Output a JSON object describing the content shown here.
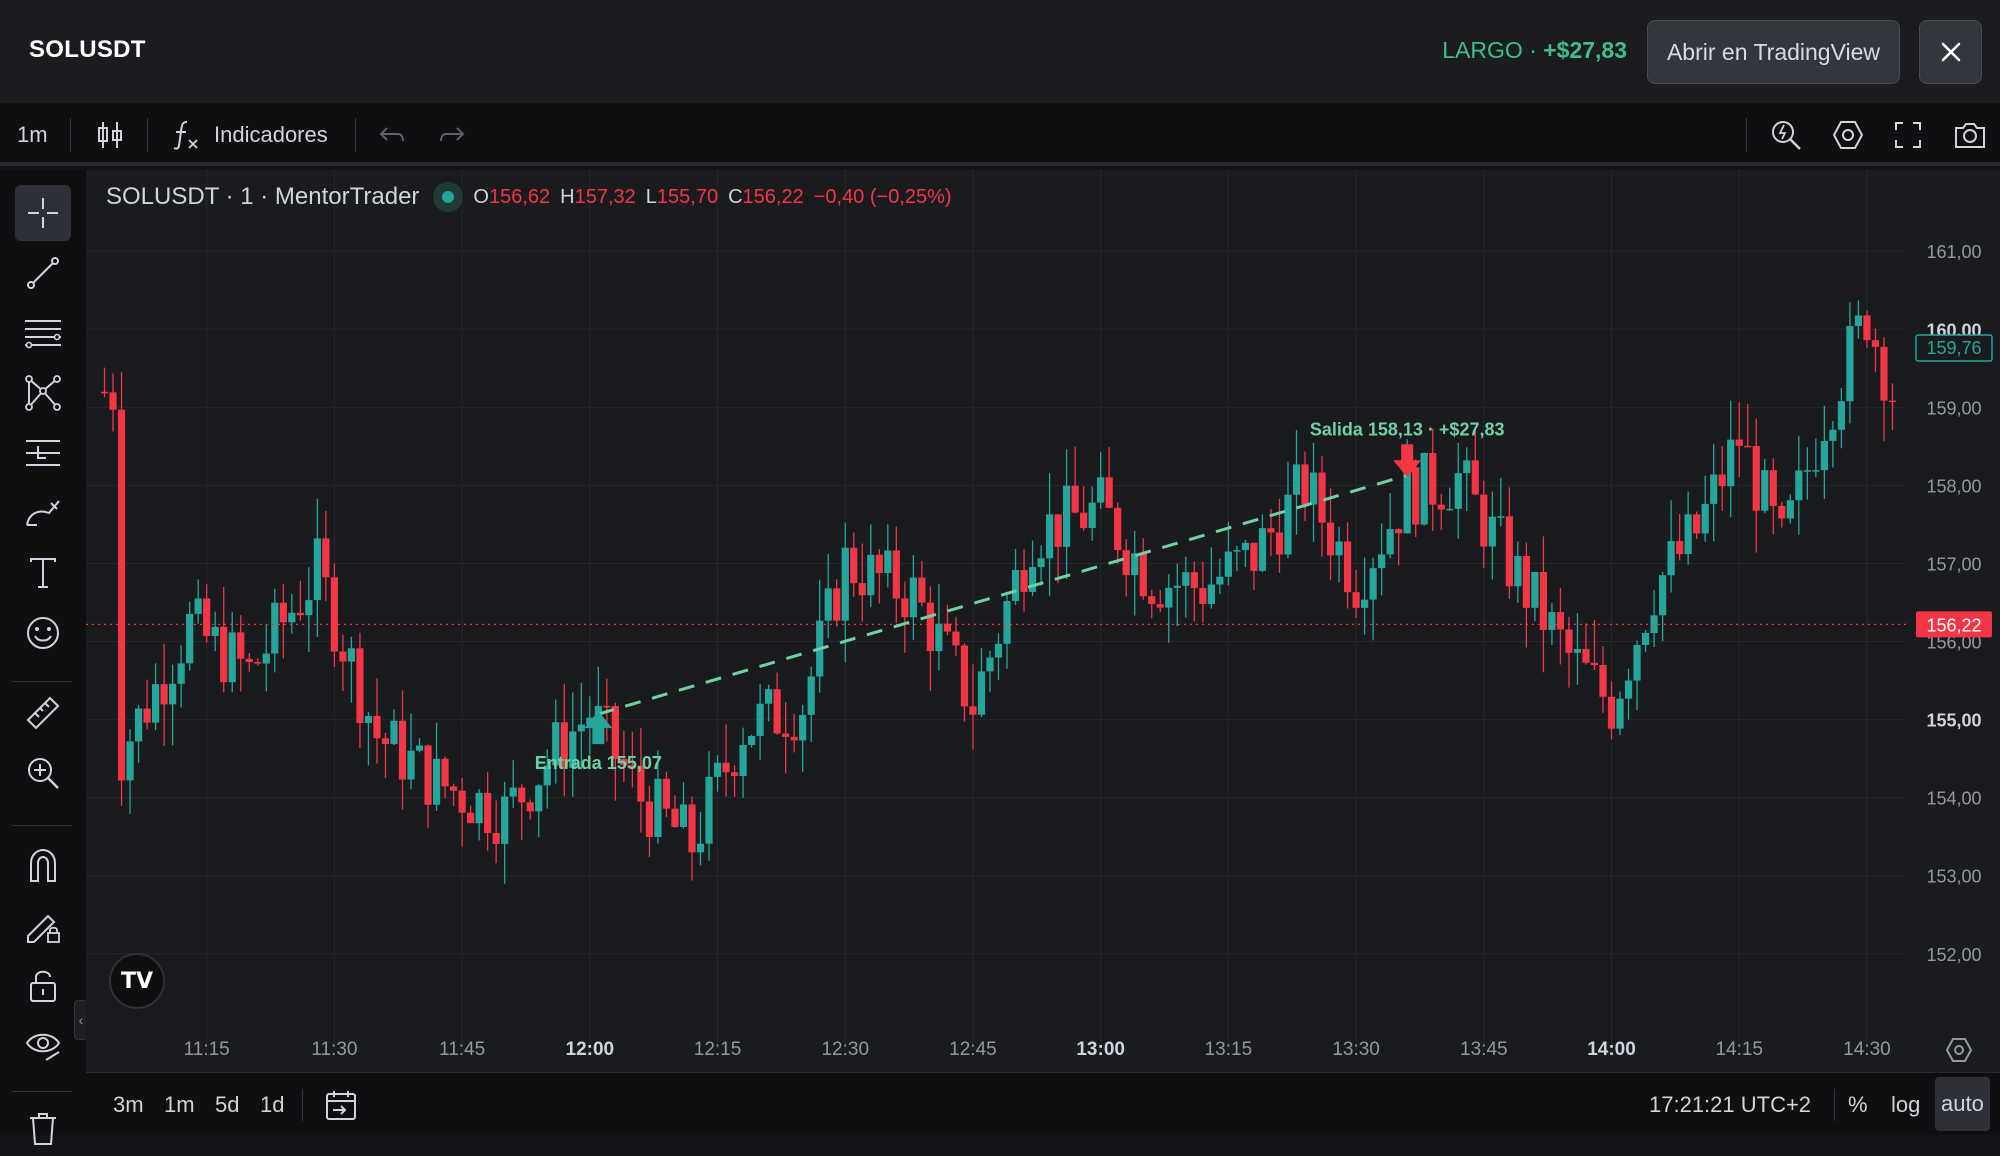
{
  "header": {
    "symbol": "SOLUSDT",
    "position_side": "LARGO",
    "position_sep": " · ",
    "position_pnl": "+$27,83",
    "open_button": "Abrir en TradingView",
    "close_icon": "close-icon"
  },
  "toolbar": {
    "interval": "1m",
    "indicators_label": "Indicadores",
    "icons": [
      "candle-style-icon",
      "function-icon",
      "undo-icon",
      "redo-icon",
      "quick-search-icon",
      "settings-hex-icon",
      "fullscreen-icon",
      "camera-icon"
    ]
  },
  "leftbar": {
    "tools": [
      "crosshair-icon",
      "trend-line-icon",
      "horizontal-lines-icon",
      "pattern-icon",
      "fib-icon",
      "brush-icon",
      "text-icon",
      "emoji-icon",
      "ruler-icon",
      "zoom-in-icon",
      "magnet-icon",
      "lock-drawing-icon",
      "unlock-icon",
      "eye-icon",
      "trash-icon"
    ]
  },
  "legend": {
    "title": "SOLUSDT · 1 · MentorTrader",
    "o_key": "O",
    "o_val": "156,62",
    "h_key": "H",
    "h_val": "157,32",
    "l_key": "L",
    "l_val": "155,70",
    "c_key": "C",
    "c_val": "156,22",
    "change": "−0,40 (−0,25%)"
  },
  "chart_data": {
    "type": "candlestick",
    "symbol": "SOLUSDT",
    "interval": "1",
    "ylim": [
      151.6,
      161.4
    ],
    "y_ticks": [
      "161,00",
      "160,00",
      "159,00",
      "158,00",
      "157,00",
      "156,00",
      "155,00",
      "154,00",
      "153,00",
      "152,00"
    ],
    "y_tick_values": [
      161,
      160,
      159,
      158,
      157,
      156,
      155,
      154,
      153,
      152
    ],
    "x_ticks": [
      "11:15",
      "11:30",
      "11:45",
      "12:00",
      "12:15",
      "12:30",
      "12:45",
      "13:00",
      "13:15",
      "13:30",
      "13:45",
      "14:00",
      "14:15",
      "14:30"
    ],
    "x_bold": [
      "12:00",
      "13:00",
      "14:00"
    ],
    "last_price": "156,22",
    "last_price_value": 156.22,
    "marked_price": "159,76",
    "marked_price_value": 159.76,
    "close_path": [
      {
        "t": "11:05",
        "p": 154.6
      },
      {
        "t": "11:13",
        "p": 156.2
      },
      {
        "t": "11:20",
        "p": 155.6
      },
      {
        "t": "11:28",
        "p": 156.9
      },
      {
        "t": "11:35",
        "p": 154.8
      },
      {
        "t": "11:42",
        "p": 154.2
      },
      {
        "t": "11:50",
        "p": 153.8
      },
      {
        "t": "11:56",
        "p": 154.6
      },
      {
        "t": "12:00",
        "p": 155.1
      },
      {
        "t": "12:06",
        "p": 154.0
      },
      {
        "t": "12:12",
        "p": 153.4
      },
      {
        "t": "12:18",
        "p": 154.9
      },
      {
        "t": "12:25",
        "p": 155.2
      },
      {
        "t": "12:30",
        "p": 157.0
      },
      {
        "t": "12:38",
        "p": 156.6
      },
      {
        "t": "12:45",
        "p": 155.2
      },
      {
        "t": "12:52",
        "p": 157.4
      },
      {
        "t": "13:00",
        "p": 157.7
      },
      {
        "t": "13:06",
        "p": 156.8
      },
      {
        "t": "13:12",
        "p": 156.7
      },
      {
        "t": "13:18",
        "p": 157.1
      },
      {
        "t": "13:24",
        "p": 158.0
      },
      {
        "t": "13:30",
        "p": 156.8
      },
      {
        "t": "13:36",
        "p": 157.9
      },
      {
        "t": "13:42",
        "p": 158.1
      },
      {
        "t": "13:48",
        "p": 157.0
      },
      {
        "t": "13:55",
        "p": 155.8
      },
      {
        "t": "14:00",
        "p": 155.2
      },
      {
        "t": "14:05",
        "p": 156.7
      },
      {
        "t": "14:10",
        "p": 157.4
      },
      {
        "t": "14:15",
        "p": 158.6
      },
      {
        "t": "14:20",
        "p": 157.2
      },
      {
        "t": "14:25",
        "p": 158.9
      },
      {
        "t": "14:30",
        "p": 160.2
      },
      {
        "t": "14:33",
        "p": 159.2
      }
    ],
    "trade": {
      "entry_label": "Entrada 155,07",
      "entry_price": 155.07,
      "entry_time": "12:01",
      "exit_label": "Salida 158,13 · +$27,83",
      "exit_price": 158.13,
      "exit_time": "13:36"
    },
    "colors": {
      "up": "#26a69a",
      "down": "#f23645",
      "grid": "#26282d",
      "trade": "#6fd1a6"
    }
  },
  "bottombar": {
    "ranges": [
      "3m",
      "1m",
      "5d",
      "1d"
    ],
    "time": "17:21:21 UTC+2",
    "percent": "%",
    "log": "log",
    "auto": "auto"
  }
}
